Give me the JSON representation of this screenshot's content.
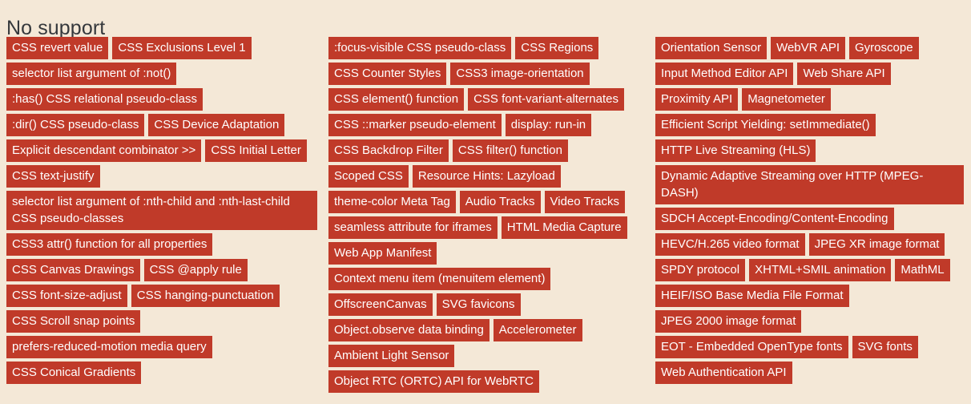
{
  "page": {
    "title": "No support",
    "accent_color": "#c03a29",
    "background_color": "#f4e8d7",
    "tag_text_color": "#ffffff",
    "title_color": "#35383c"
  },
  "columns": [
    {
      "name": "column-left",
      "tags": [
        {
          "label": "CSS revert value",
          "wrap": false
        },
        {
          "label": "CSS Exclusions Level 1",
          "wrap": false
        },
        {
          "label": "selector list argument of :not()",
          "wrap": false
        },
        {
          "label": ":has() CSS relational pseudo-class",
          "wrap": false
        },
        {
          "label": ":dir() CSS pseudo-class",
          "wrap": false
        },
        {
          "label": "CSS Device Adaptation",
          "wrap": false
        },
        {
          "label": "Explicit descendant combinator >>",
          "wrap": false
        },
        {
          "label": "CSS Initial Letter",
          "wrap": false
        },
        {
          "label": "CSS text-justify",
          "wrap": false
        },
        {
          "label": "selector list argument of :nth-child and :nth-last-child CSS pseudo-classes",
          "wrap": true
        },
        {
          "label": "CSS3 attr() function for all properties",
          "wrap": false
        },
        {
          "label": "CSS Canvas Drawings",
          "wrap": false
        },
        {
          "label": "CSS @apply rule",
          "wrap": false
        },
        {
          "label": "CSS font-size-adjust",
          "wrap": false
        },
        {
          "label": "CSS hanging-punctuation",
          "wrap": false
        },
        {
          "label": "CSS Scroll snap points",
          "wrap": false
        },
        {
          "label": "prefers-reduced-motion media query",
          "wrap": false
        },
        {
          "label": "CSS Conical Gradients",
          "wrap": false
        }
      ]
    },
    {
      "name": "column-middle",
      "tags": [
        {
          "label": ":focus-visible CSS pseudo-class",
          "wrap": false
        },
        {
          "label": "CSS Regions",
          "wrap": false
        },
        {
          "label": "CSS Counter Styles",
          "wrap": false
        },
        {
          "label": "CSS3 image-orientation",
          "wrap": false
        },
        {
          "label": "CSS element() function",
          "wrap": false
        },
        {
          "label": "CSS font-variant-alternates",
          "wrap": false
        },
        {
          "label": "CSS ::marker pseudo-element",
          "wrap": false
        },
        {
          "label": "display: run-in",
          "wrap": false
        },
        {
          "label": "CSS Backdrop Filter",
          "wrap": false
        },
        {
          "label": "CSS filter() function",
          "wrap": false
        },
        {
          "label": "Scoped CSS",
          "wrap": false
        },
        {
          "label": "Resource Hints: Lazyload",
          "wrap": false
        },
        {
          "label": "theme-color Meta Tag",
          "wrap": false
        },
        {
          "label": "Audio Tracks",
          "wrap": false
        },
        {
          "label": "Video Tracks",
          "wrap": false
        },
        {
          "label": "seamless attribute for iframes",
          "wrap": false
        },
        {
          "label": "HTML Media Capture",
          "wrap": false
        },
        {
          "label": "Web App Manifest",
          "wrap": false
        },
        {
          "label": "Context menu item (menuitem element)",
          "wrap": false
        },
        {
          "label": "OffscreenCanvas",
          "wrap": false
        },
        {
          "label": "SVG favicons",
          "wrap": false
        },
        {
          "label": "Object.observe data binding",
          "wrap": false
        },
        {
          "label": "Accelerometer",
          "wrap": false
        },
        {
          "label": "Ambient Light Sensor",
          "wrap": false
        },
        {
          "label": "Object RTC (ORTC) API for WebRTC",
          "wrap": false
        }
      ]
    },
    {
      "name": "column-right",
      "tags": [
        {
          "label": "Orientation Sensor",
          "wrap": false
        },
        {
          "label": "WebVR API",
          "wrap": false
        },
        {
          "label": "Gyroscope",
          "wrap": false
        },
        {
          "label": "Input Method Editor API",
          "wrap": false
        },
        {
          "label": "Web Share API",
          "wrap": false
        },
        {
          "label": "Proximity API",
          "wrap": false
        },
        {
          "label": "Magnetometer",
          "wrap": false
        },
        {
          "label": "Efficient Script Yielding: setImmediate()",
          "wrap": false
        },
        {
          "label": "HTTP Live Streaming (HLS)",
          "wrap": false
        },
        {
          "label": "Dynamic Adaptive Streaming over HTTP (MPEG-DASH)",
          "wrap": true
        },
        {
          "label": "SDCH Accept-Encoding/Content-Encoding",
          "wrap": false
        },
        {
          "label": "HEVC/H.265 video format",
          "wrap": false
        },
        {
          "label": "JPEG XR image format",
          "wrap": false
        },
        {
          "label": "SPDY protocol",
          "wrap": false
        },
        {
          "label": "XHTML+SMIL animation",
          "wrap": false
        },
        {
          "label": "MathML",
          "wrap": false
        },
        {
          "label": "HEIF/ISO Base Media File Format",
          "wrap": false
        },
        {
          "label": "JPEG 2000 image format",
          "wrap": false
        },
        {
          "label": "EOT - Embedded OpenType fonts",
          "wrap": false
        },
        {
          "label": "SVG fonts",
          "wrap": false
        },
        {
          "label": "Web Authentication API",
          "wrap": false
        }
      ]
    }
  ]
}
